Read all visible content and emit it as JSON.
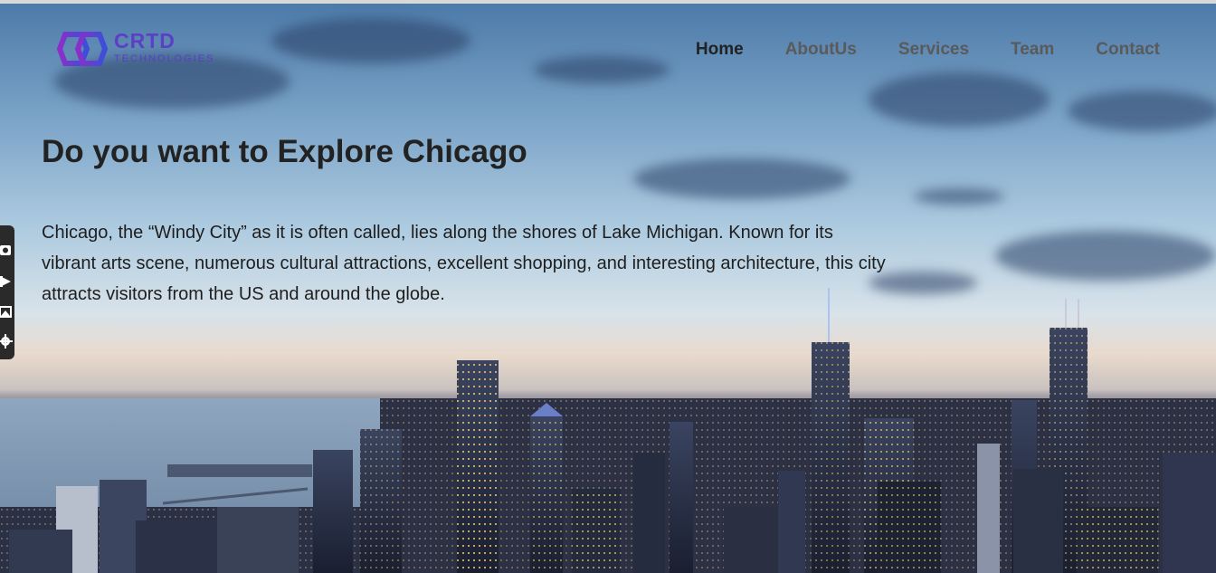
{
  "logo": {
    "title": "CRTD",
    "subtitle": "TECHNOLOGIES"
  },
  "nav": [
    {
      "label": "Home",
      "active": true
    },
    {
      "label": "AboutUs",
      "active": false
    },
    {
      "label": "Services",
      "active": false
    },
    {
      "label": "Team",
      "active": false
    },
    {
      "label": "Contact",
      "active": false
    }
  ],
  "hero": {
    "title": "Do you want to Explore Chicago",
    "text": "Chicago, the “Windy City” as it is often called, lies along the shores of Lake Michigan. Known for its vibrant arts scene, numerous cultural attractions, excellent shopping, and interesting architecture, this city attracts visitors from the US and around the globe."
  },
  "sidebar_tools": [
    "camera-icon",
    "video-icon",
    "screenshot-icon",
    "gear-icon"
  ],
  "colors": {
    "brand": "#5b3fc4",
    "nav_active": "#222222",
    "nav": "#5a5a5a"
  }
}
